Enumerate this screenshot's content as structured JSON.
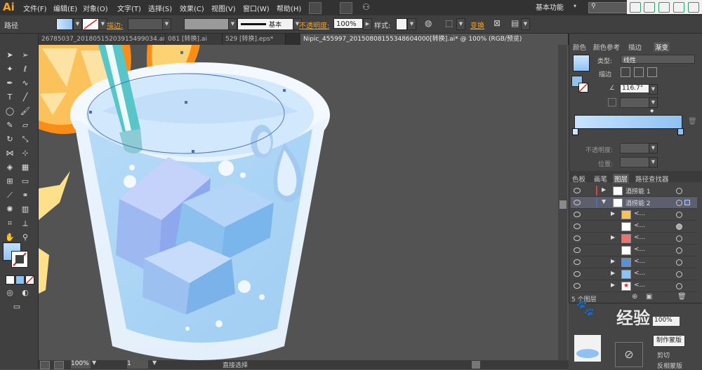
{
  "app": {
    "logo": "Ai"
  },
  "menu": [
    "文件(F)",
    "编辑(E)",
    "对象(O)",
    "文字(T)",
    "选择(S)",
    "效果(C)",
    "视图(V)",
    "窗口(W)",
    "帮助(H)"
  ],
  "workspace": "基本功能",
  "control": {
    "object_type": "路径",
    "stroke_label": "描边:",
    "brush_label": "基本",
    "opacity_label": "不透明度:",
    "opacity_value": "100%",
    "style_label": "样式:",
    "transform_label": "变换"
  },
  "tabs": [
    {
      "label": "26785037_20180515203915499034.ai*",
      "active": false
    },
    {
      "label": "081 [转换].ai",
      "active": false
    },
    {
      "label": "529 [转换].eps*",
      "active": false
    },
    {
      "label": "Nipic_455997_20150808155348604000[转换].ai* @ 100% (RGB/预览)",
      "active": true
    }
  ],
  "status": {
    "zoom": "100%",
    "artboard": "1",
    "tool": "直接选择"
  },
  "gradient_panel": {
    "tabs": [
      "颜色",
      "颜色参考",
      "描边",
      "渐变"
    ],
    "type_label": "类型:",
    "type_value": "线性",
    "stroke_label": "描边",
    "angle": "116.7°",
    "opacity_label": "不透明度:",
    "position_label": "位置:"
  },
  "layers_panel": {
    "tabs": [
      "色板",
      "画笔",
      "图层",
      "路径查找器"
    ],
    "layers": [
      {
        "name": "酒捞能 1",
        "expanded": false,
        "level": 0
      },
      {
        "name": "酒捞能 2",
        "expanded": true,
        "level": 0,
        "selected": true
      },
      {
        "name": "<...",
        "level": 1
      },
      {
        "name": "<...",
        "level": 1
      },
      {
        "name": "<...",
        "level": 1
      },
      {
        "name": "<...",
        "level": 1
      },
      {
        "name": "<...",
        "level": 1
      },
      {
        "name": "<...",
        "level": 1
      },
      {
        "name": "<...",
        "level": 1
      }
    ],
    "count": "5 个图层"
  },
  "transparency_panel": {
    "opacity_value": "100%",
    "make_mask": "制作蒙版",
    "clip": "剪切",
    "invert_mask": "反相蒙版"
  },
  "watermark": "经验",
  "colors": {
    "accent": "#f7a31c",
    "selection": "#4a6fb5",
    "gradient_start": "#c8e3ff",
    "gradient_end": "#8fc2f3"
  }
}
